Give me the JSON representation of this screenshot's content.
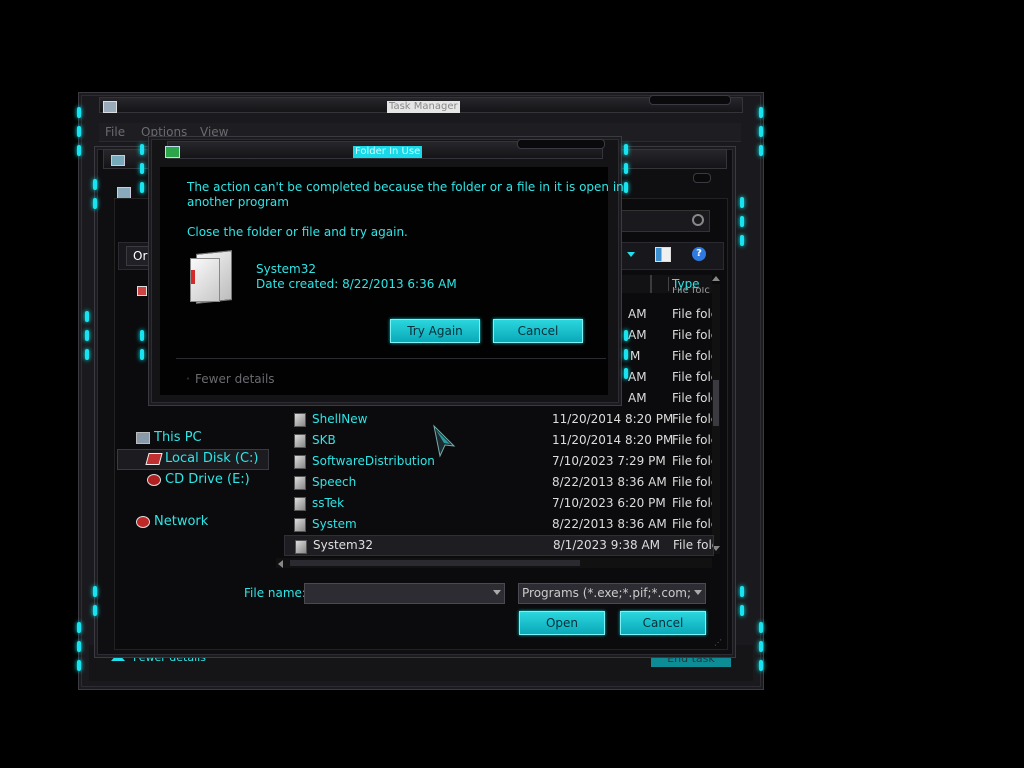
{
  "task_manager": {
    "title": "Task Manager",
    "menu": [
      "File",
      "Options",
      "View"
    ],
    "fewer_details": "Fewer details",
    "end_task": "End task"
  },
  "file_dialog": {
    "nav": {
      "this_pc": "This PC",
      "local_disk": "Local Disk (C:)",
      "cd_drive": "CD Drive (E:)",
      "network": "Network"
    },
    "toolbar_organize": "Or",
    "column_type": "Type",
    "hidden_rows": [
      {
        "date": "AM",
        "type": "File folc"
      },
      {
        "date": "AM",
        "type": "File folc"
      },
      {
        "date": "M",
        "type": "File folc"
      },
      {
        "date": "AM",
        "type": "File folc"
      },
      {
        "date": "AM",
        "type": "File folc"
      }
    ],
    "partial_type": "File folc",
    "rows": [
      {
        "name": "ShellNew",
        "date": "11/20/2014 8:20 PM",
        "type": "File folc"
      },
      {
        "name": "SKB",
        "date": "11/20/2014 8:20 PM",
        "type": "File folc"
      },
      {
        "name": "SoftwareDistribution",
        "date": "7/10/2023 7:29 PM",
        "type": "File folc"
      },
      {
        "name": "Speech",
        "date": "8/22/2013 8:36 AM",
        "type": "File folc"
      },
      {
        "name": "ssTek",
        "date": "7/10/2023 6:20 PM",
        "type": "File folc"
      },
      {
        "name": "System",
        "date": "8/22/2013 8:36 AM",
        "type": "File folc"
      },
      {
        "name": "System32",
        "date": "8/1/2023 9:38 AM",
        "type": "File folc"
      }
    ],
    "file_name_label": "File name:",
    "file_name_value": "",
    "filter": "Programs (*.exe;*.pif;*.com;*.ba",
    "open": "Open",
    "cancel": "Cancel"
  },
  "alert": {
    "title": "Folder In Use",
    "message_line1": "The action can't be completed because the folder or a file in it is open in",
    "message_line2": "another program",
    "instruction": "Close the folder or file and try again.",
    "item_name": "System32",
    "item_date": "Date created: 8/22/2013 6:36 AM",
    "try_again": "Try Again",
    "cancel": "Cancel",
    "fewer_details": "Fewer details"
  },
  "colors": {
    "accent": "#2ee6e6",
    "led": "#19e3f0",
    "background": "#000000",
    "panel": "#101013"
  }
}
